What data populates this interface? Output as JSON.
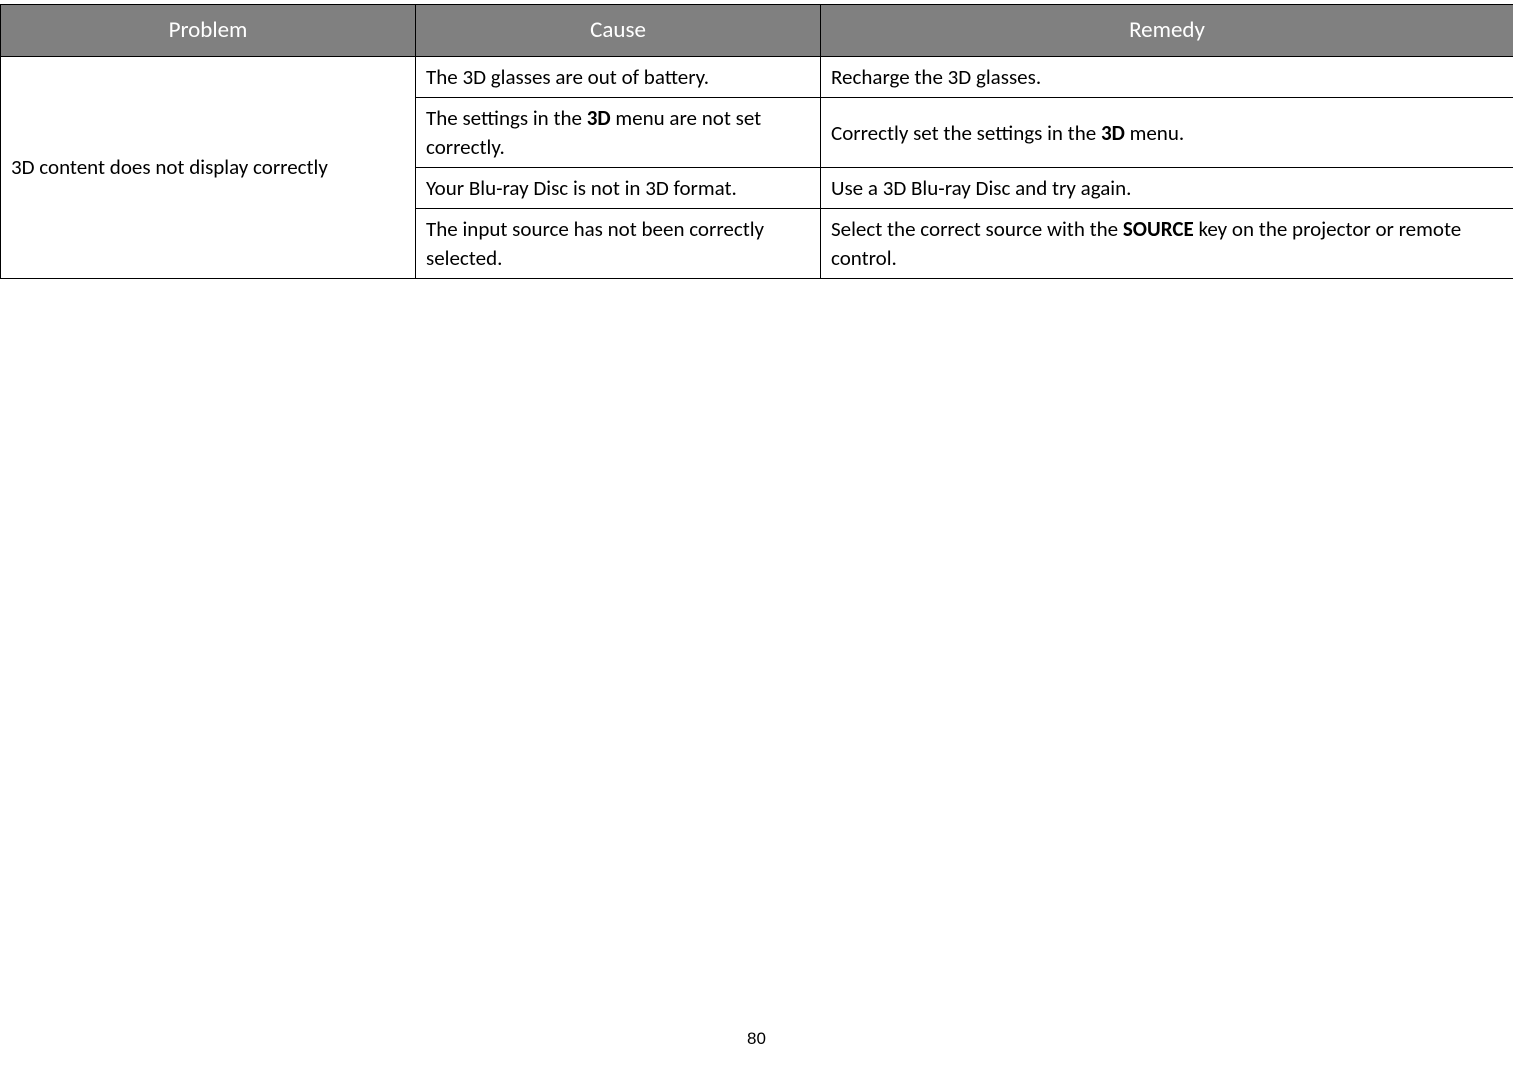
{
  "table": {
    "headers": [
      "Problem",
      "Cause",
      "Remedy"
    ],
    "problem": "3D content does not display correctly",
    "rows": [
      {
        "cause_parts": [
          "The 3D glasses are out of battery."
        ],
        "remedy_parts": [
          "Recharge the 3D glasses."
        ]
      },
      {
        "cause_parts": [
          "The settings in the ",
          "3D",
          " menu are not set correctly."
        ],
        "remedy_parts": [
          "Correctly set the settings in the ",
          "3D",
          " menu."
        ]
      },
      {
        "cause_parts": [
          "Your Blu-ray Disc is not in 3D format."
        ],
        "remedy_parts": [
          "Use a 3D Blu-ray Disc and try again."
        ]
      },
      {
        "cause_parts": [
          "The input source has not been correctly selected."
        ],
        "remedy_parts": [
          "Select the correct source with the ",
          "SOURCE",
          " key on the projector or remote control."
        ]
      }
    ]
  },
  "page_number": "80"
}
